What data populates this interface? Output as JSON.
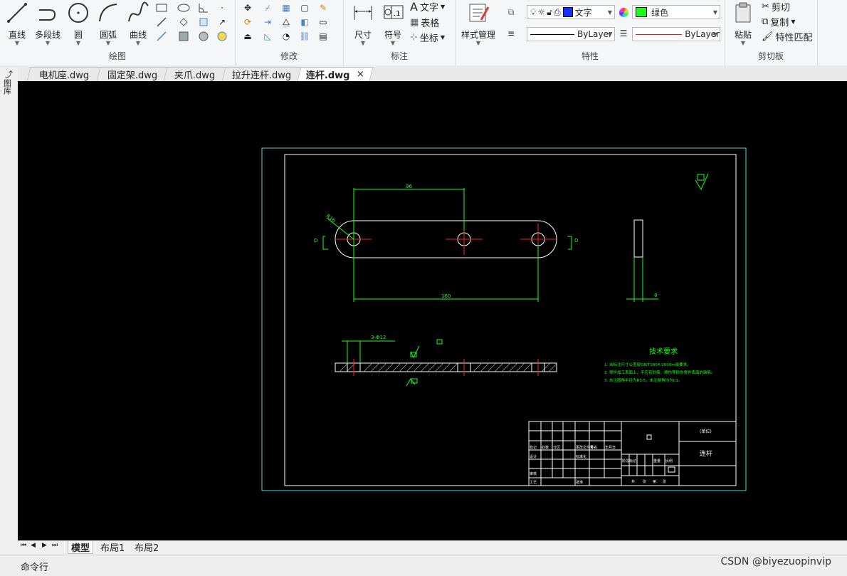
{
  "ribbon": {
    "draw": {
      "label": "绘图",
      "line": "直线",
      "polyline": "多段线",
      "circle": "圆",
      "arc": "圆弧",
      "curve": "曲线"
    },
    "modify": {
      "label": "修改"
    },
    "annotate": {
      "label": "标注",
      "dimension": "尺寸",
      "symbol": "符号",
      "text": "文字",
      "table": "表格",
      "coord": "坐标"
    },
    "properties": {
      "label": "特性",
      "style_manager": "样式管理",
      "layer_value": "文字",
      "color_value": "绿色",
      "linetype_value": "ByLayer",
      "lineweight_value": "ByLayer"
    },
    "clipboard": {
      "label": "剪切板",
      "paste": "粘贴",
      "cut": "剪切",
      "copy": "复制",
      "match": "特性匹配"
    }
  },
  "file_tabs": [
    "电机座.dwg",
    "固定架.dwg",
    "夹爪.dwg",
    "拉升连杆.dwg",
    "连杆.dwg"
  ],
  "active_tab_index": 4,
  "left_panel": {
    "label": "图库"
  },
  "drawing": {
    "dim_top": "96",
    "dim_bottom": "160",
    "dim_radius": "R16",
    "dim_thickness": "8",
    "dim_section": "3-Φ12",
    "section_mark_left": "D",
    "section_mark_right": "D",
    "tech_title": "技术要求",
    "tech_notes": [
      "1. 未标注尺寸公差按GB/T1804-2000m级要求。",
      "2. 零件加工表面上，不应有划痕、擦伤等损伤零件表面的缺陷。",
      "3. 未注圆角半径为R0.5，未注倒角均为C1。"
    ],
    "title_block": {
      "part_name": "连杆",
      "unit": "(单位)",
      "row_labels": [
        "标记",
        "处数",
        "分区",
        "更改文件号",
        "签名",
        "年月日"
      ],
      "row_labels2": [
        "设计",
        "标准化",
        "阶段标记",
        "重量",
        "比例"
      ],
      "row_labels3": [
        "审核"
      ],
      "row_labels4": [
        "工艺",
        "批准"
      ],
      "sheet_info": [
        "共",
        "张",
        "第",
        "张"
      ]
    }
  },
  "layout_tabs": [
    "模型",
    "布局1",
    "布局2"
  ],
  "command_label": "命令行",
  "watermark": "CSDN @biyezuopinvip",
  "colors": {
    "green": "#19ff19",
    "cyan_frame": "#40e0d0",
    "red": "#ff2020",
    "layer_swatch": "#19ff19"
  }
}
